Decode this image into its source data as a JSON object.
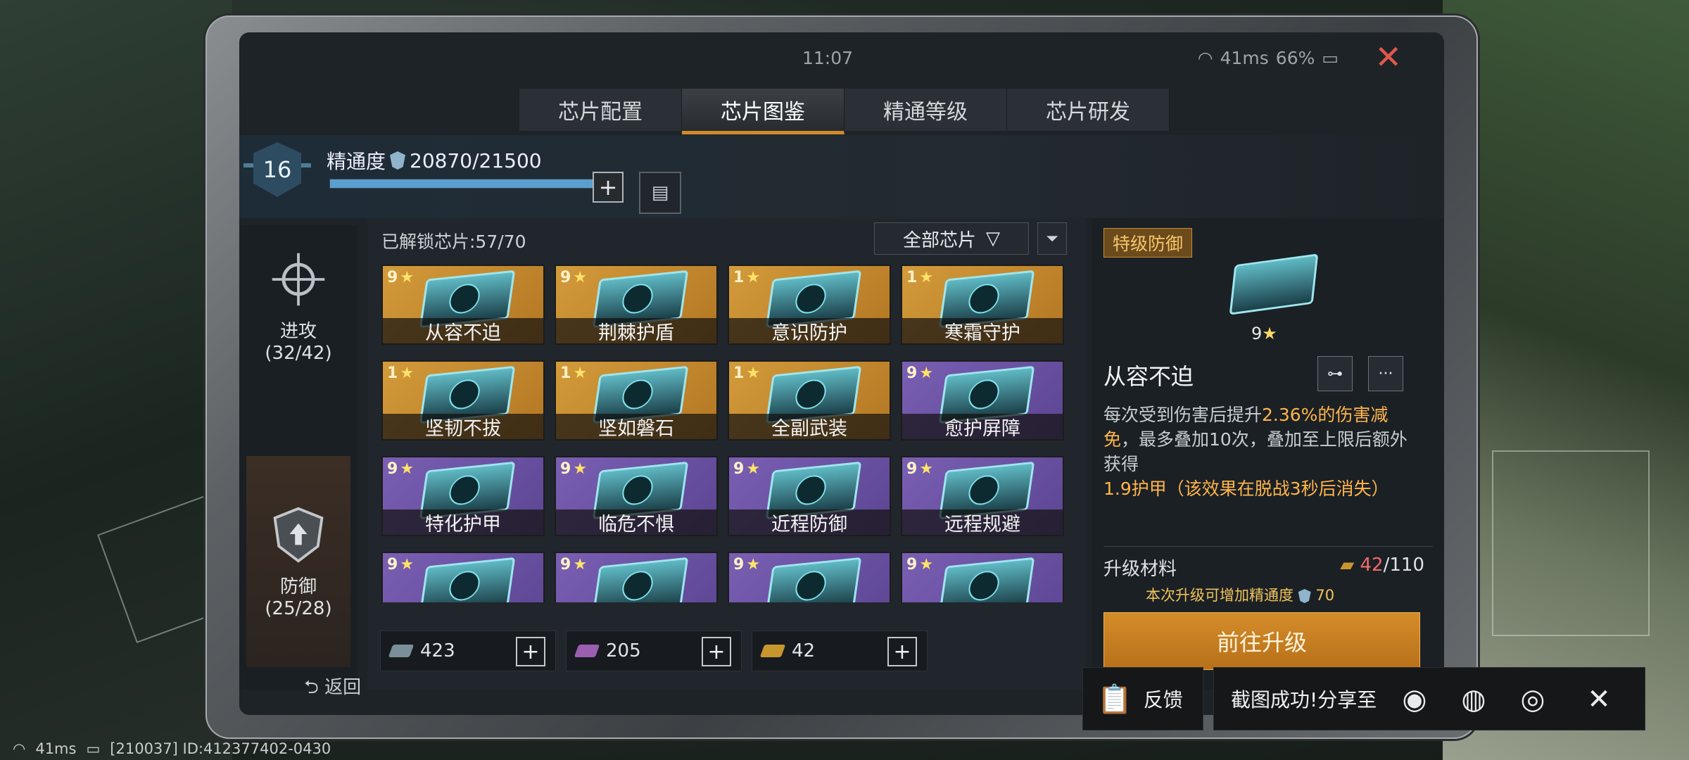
{
  "statusbar": {
    "time": "11:07",
    "ping": "41ms",
    "battery": "66%"
  },
  "tabs": [
    {
      "label": "芯片配置",
      "active": false
    },
    {
      "label": "芯片图鉴",
      "active": true
    },
    {
      "label": "精通等级",
      "active": false
    },
    {
      "label": "芯片研发",
      "active": false
    }
  ],
  "mastery": {
    "level": "16",
    "label": "精通度",
    "value": "20870/21500",
    "progress": 0.97
  },
  "leftnav": [
    {
      "label": "进攻",
      "count": "(32/42)"
    },
    {
      "label": "防御",
      "count": "(25/28)"
    }
  ],
  "grid": {
    "unlocked": "已解锁芯片:57/70",
    "filter": "全部芯片",
    "chips": [
      {
        "stars": "9",
        "name": "从容不迫",
        "rarity": "gold"
      },
      {
        "stars": "9",
        "name": "荆棘护盾",
        "rarity": "gold"
      },
      {
        "stars": "1",
        "name": "意识防护",
        "rarity": "gold"
      },
      {
        "stars": "1",
        "name": "寒霜守护",
        "rarity": "gold"
      },
      {
        "stars": "1",
        "name": "坚韧不拔",
        "rarity": "gold"
      },
      {
        "stars": "1",
        "name": "坚如磐石",
        "rarity": "gold"
      },
      {
        "stars": "1",
        "name": "全副武装",
        "rarity": "gold"
      },
      {
        "stars": "9",
        "name": "愈护屏障",
        "rarity": "purple"
      },
      {
        "stars": "9",
        "name": "特化护甲",
        "rarity": "purple"
      },
      {
        "stars": "9",
        "name": "临危不惧",
        "rarity": "purple"
      },
      {
        "stars": "9",
        "name": "近程防御",
        "rarity": "purple"
      },
      {
        "stars": "9",
        "name": "远程规避",
        "rarity": "purple"
      },
      {
        "stars": "9",
        "name": "",
        "rarity": "purple"
      },
      {
        "stars": "9",
        "name": "",
        "rarity": "purple"
      },
      {
        "stars": "9",
        "name": "",
        "rarity": "purple"
      },
      {
        "stars": "9",
        "name": "",
        "rarity": "purple"
      }
    ]
  },
  "currencies": [
    {
      "value": "423",
      "color": "#7a8f9a"
    },
    {
      "value": "205",
      "color": "#9a5fae"
    },
    {
      "value": "42",
      "color": "#c8962f"
    }
  ],
  "detail": {
    "rank": "特级防御",
    "stars": "9",
    "name": "从容不迫",
    "desc_1": "每次受到伤害后提升",
    "desc_hl1": "2.36%的伤害减免",
    "desc_2": "，最多叠加10次，叠加至上限后额外获得",
    "desc_hl2": "1.9护甲（该效果在脱战3秒后消失）",
    "upgrade_label": "升级材料",
    "upgrade_have": "42",
    "upgrade_need": "/110",
    "upgrade_note": "本次升级可增加精通度",
    "upgrade_note_value": "70",
    "upgrade_button": "前往升级"
  },
  "back_label": "返回",
  "overlay": {
    "feedback": "反馈",
    "share_text": "截图成功!分享至"
  },
  "bottom_status": {
    "ping": "41ms",
    "id": "[210037] ID:412377402-0430"
  }
}
